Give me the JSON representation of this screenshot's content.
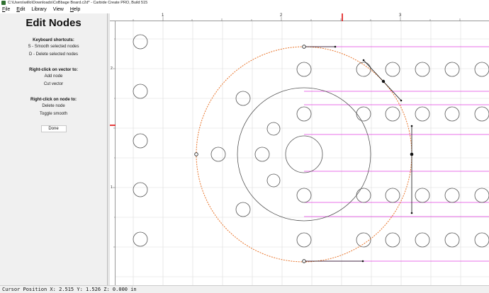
{
  "window": {
    "title": "C:\\Users\\willo\\Downloads\\CoBbage Board.c2d* - Carbide Create PRO, Build 515",
    "icon": "carbide-create-app-icon"
  },
  "menu": [
    {
      "underline": "F",
      "rest": "ile"
    },
    {
      "underline": "E",
      "rest": "dit"
    },
    {
      "underline": "",
      "rest": "Library"
    },
    {
      "underline": "",
      "rest": "View"
    },
    {
      "underline": "H",
      "rest": "elp"
    }
  ],
  "panel": {
    "title": "Edit Nodes",
    "shortcuts_head": "Keyboard shortcuts:",
    "shortcut_smooth": "S - Smooth selected nodes",
    "shortcut_delete": "D - Delete selected nodes",
    "vector_head": "Right-click on vector to:",
    "vector_add": "Add node",
    "vector_cut": "Cut vector",
    "node_head": "Right-click on node to:",
    "node_delete": "Delete node",
    "node_toggle": "Toggle smooth",
    "done_label": "Done"
  },
  "ruler": {
    "h_labels": [
      "1",
      "2",
      "3"
    ],
    "v_labels": [
      "2",
      "1"
    ]
  },
  "colors": {
    "selected_path": "#e8742a",
    "guide_lines": "#e040e0",
    "shape_stroke": "#555555",
    "grid": "#d9d9d9",
    "ruler_marker": "#e01010"
  },
  "status": {
    "cursor": "Cursor Position X: 2.515 Y: 1.526 Z: 0.000 in"
  }
}
